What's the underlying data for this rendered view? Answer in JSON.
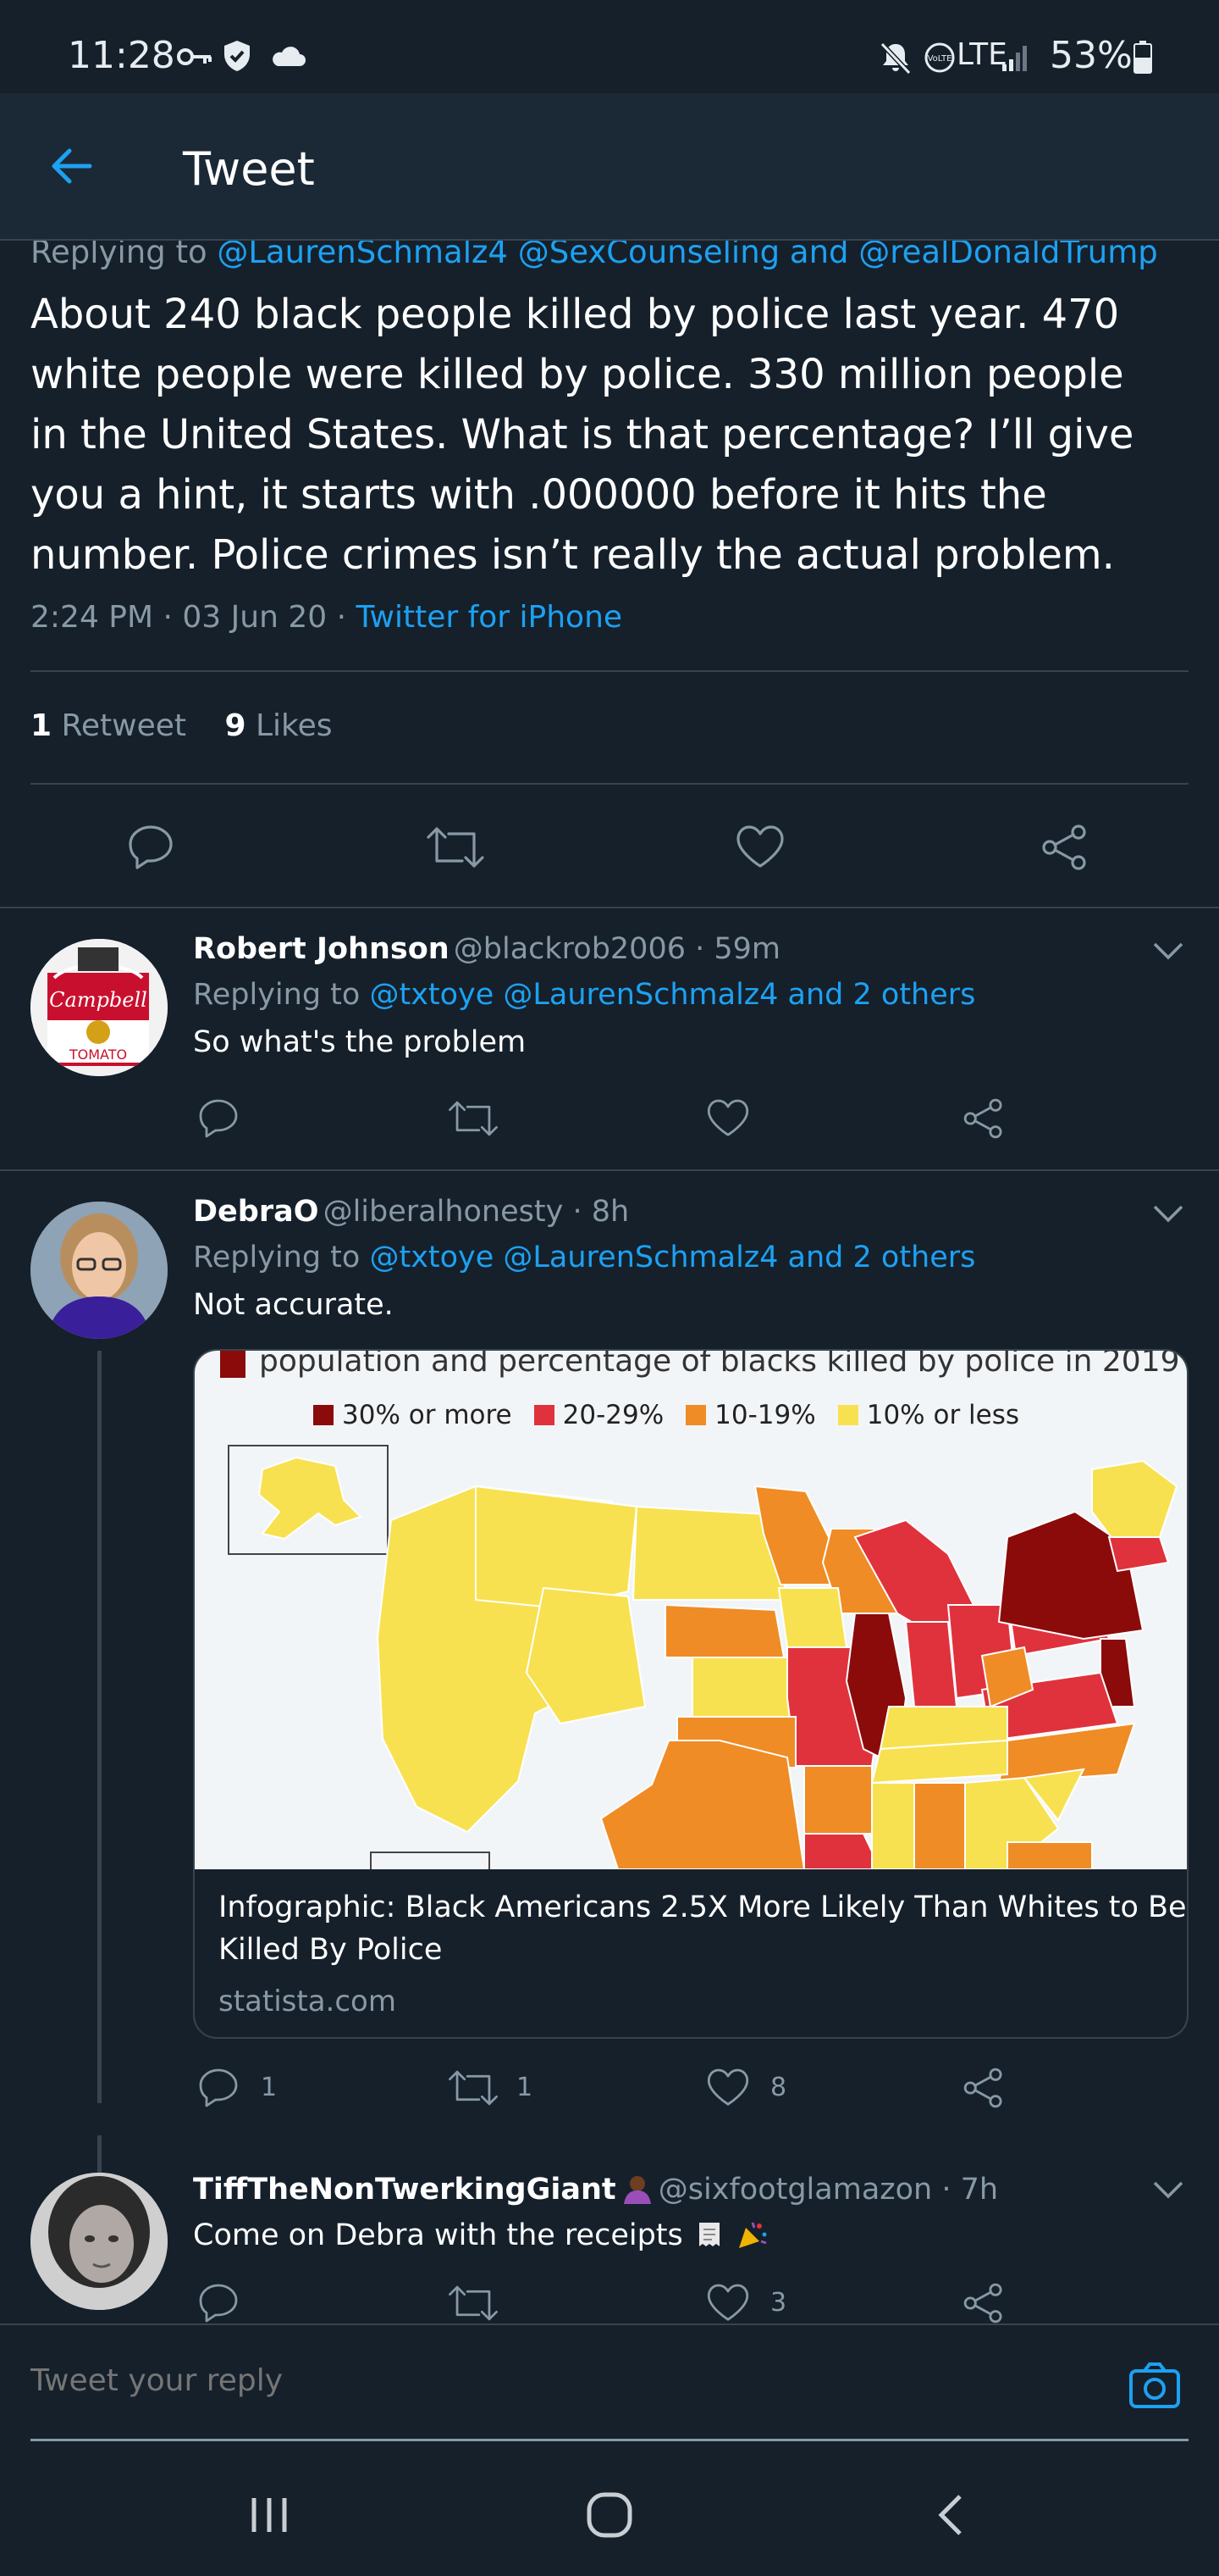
{
  "status_bar": {
    "time": "11:28",
    "network": "LTE",
    "battery": "53%"
  },
  "header": {
    "title": "Tweet"
  },
  "main_tweet": {
    "replying_prefix": "Replying to",
    "replying_handles": "@LaurenSchmalz4 @SexCounseling and @realDonaldTrump",
    "lines": [
      "About 240 black people killed by police last year. 470",
      "white people were killed by police. 330 million people",
      "in the United States.  What is that percentage? I’ll give",
      "you a hint, it starts with .000000 before it hits the",
      "number.  Police crimes isn’t really the actual problem."
    ],
    "time": "2:24 PM · 03 Jun 20 ·",
    "source": "Twitter for iPhone",
    "retweets_count": "1",
    "retweets_label": "Retweet",
    "likes_count": "9",
    "likes_label": "Likes"
  },
  "replies": [
    {
      "name": "Robert Johnson",
      "handle": "@blackrob2006 · 59m",
      "replying_prefix": "Replying to",
      "replying_handles": "@txtoye @LaurenSchmalz4 and 2 others",
      "text": "So what's the problem"
    },
    {
      "name": "DebraO",
      "handle": "@liberalhonesty · 8h",
      "replying_prefix": "Replying to",
      "replying_handles": "@txtoye @LaurenSchmalz4 and 2 others",
      "text": "Not accurate.",
      "card": {
        "image_title": "population and percentage of blacks killed by police in 2019",
        "legend": [
          {
            "label": "30% or more",
            "color": "#8b0a0a"
          },
          {
            "label": "20-29%",
            "color": "#e0323c"
          },
          {
            "label": "10-19%",
            "color": "#ef8c26"
          },
          {
            "label": "10% or less",
            "color": "#f8e150"
          }
        ],
        "headline_1": "Infographic: Black Americans 2.5X More Likely Than Whites to Be",
        "headline_2": "Killed By Police",
        "domain": "statista.com"
      },
      "reply_count": "1",
      "retweet_count": "1",
      "like_count": "8"
    },
    {
      "name": "TiffTheNonTwerkingGiant",
      "handle": "@sixfootglamazon · 7h",
      "text": "Come on Debra with the receipts",
      "like_count": "3"
    }
  ],
  "composer": {
    "placeholder": "Tweet your reply"
  },
  "colors": {
    "background": "#15202b",
    "accent": "#1da1f2",
    "muted": "#8899a6",
    "border": "#38444d"
  }
}
